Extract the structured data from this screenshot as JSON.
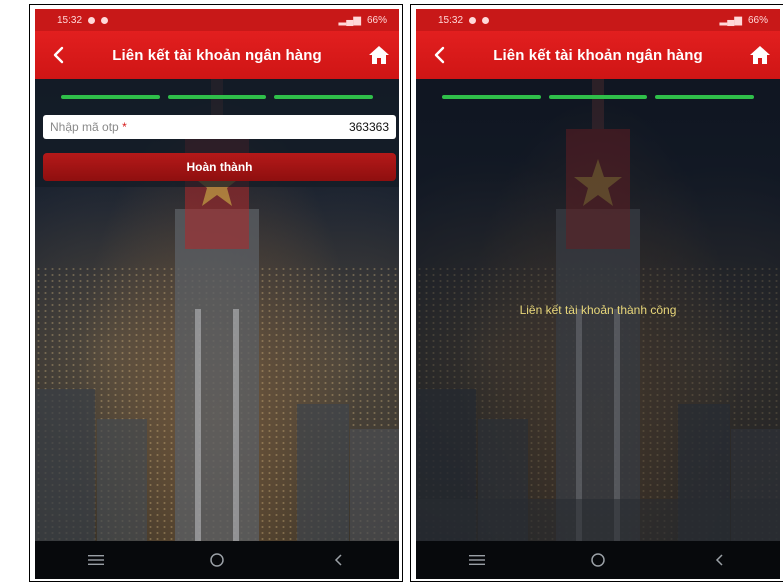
{
  "colors": {
    "appbar": "#d81a1a",
    "progress_active": "#2fbf4a",
    "success_text": "#e8d77a",
    "required": "#d61a1a"
  },
  "screens": [
    {
      "status": {
        "time": "15:32",
        "battery": "66%"
      },
      "appbar": {
        "back_icon": "chevron-left-icon",
        "title": "Liên kết tài khoản ngân hàng",
        "home_icon": "home-icon"
      },
      "otp": {
        "placeholder": "Nhập mã otp",
        "required_mark": "*",
        "value": "363363"
      },
      "submit_label": "Hoàn thành",
      "nav": {
        "menu_icon": "menu-icon",
        "home_icon": "circle-icon",
        "back_icon": "back-icon"
      }
    },
    {
      "status": {
        "time": "15:32",
        "battery": "66%"
      },
      "appbar": {
        "back_icon": "chevron-left-icon",
        "title": "Liên kết tài khoản ngân hàng",
        "home_icon": "home-icon"
      },
      "message": "Liên kết tài khoản thành công",
      "nav": {
        "menu_icon": "menu-icon",
        "home_icon": "circle-icon",
        "back_icon": "back-icon"
      }
    }
  ]
}
